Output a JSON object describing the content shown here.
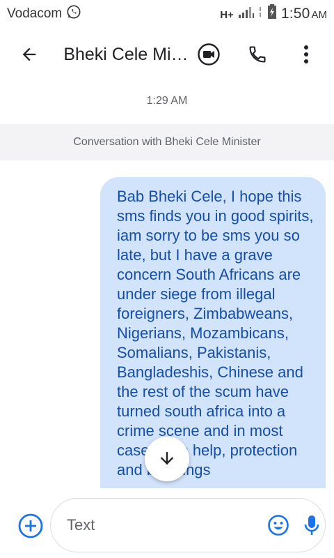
{
  "status_bar": {
    "carrier": "Vodacom",
    "network": "H+",
    "time": "1:50",
    "ampm": "AM"
  },
  "app_bar": {
    "title": "Bheki Cele Minister",
    "icons": [
      "back-arrow-icon",
      "video-call-icon",
      "phone-icon",
      "more-vert-icon"
    ]
  },
  "conversation": {
    "timestamp": "1:29 AM",
    "banner": "Conversation with Bheki Cele Minister"
  },
  "message": {
    "text": "Bab Bheki Cele, I hope this sms finds you in good spirits, iam sorry to be sms you so late, but I have a grave concern South Africans are under siege from illegal foreigners, Zimbabweans, Nigerians, Mozambicans, Somalians, Pakistanis, Bangladeshis, Chinese and the rest of the scum have turned south africa into a crime scene and in most cases with help, protection and blessings"
  },
  "compose": {
    "placeholder": "Text",
    "icons": [
      "add-circle-icon",
      "emoji-icon",
      "mic-icon"
    ]
  },
  "colors": {
    "accent": "#1a73e8",
    "bubble_bg": "#d2e3fc",
    "bubble_text": "#174ea6",
    "banner_bg": "#f3f3f5"
  }
}
